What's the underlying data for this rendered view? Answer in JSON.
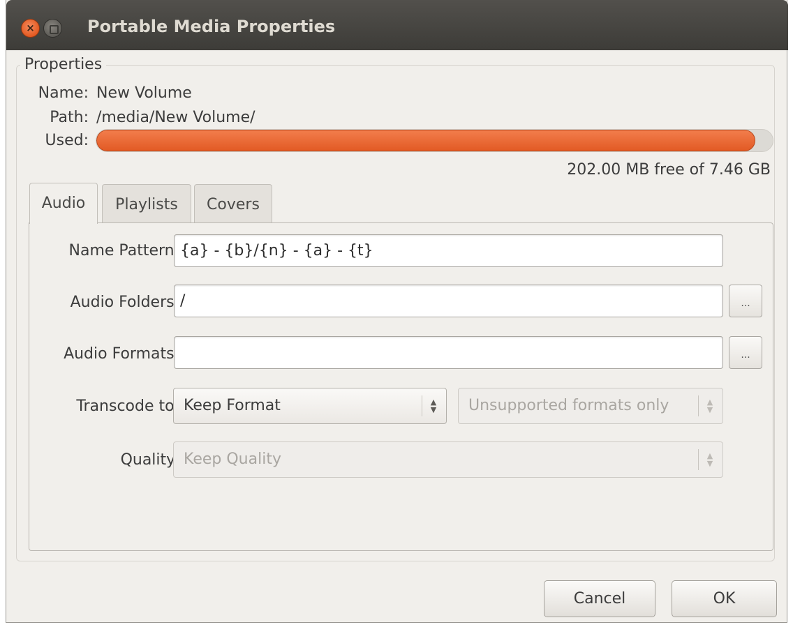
{
  "window": {
    "title": "Portable Media Properties",
    "close_glyph": "×"
  },
  "properties": {
    "group_title": "Properties",
    "name_label": "Name:",
    "name_value": "New Volume",
    "path_label": "Path:",
    "path_value": "/media/New Volume/",
    "used_label": "Used:",
    "used_fraction": 0.974,
    "free_text": "202.00 MB free of 7.46 GB"
  },
  "tabs": [
    {
      "label": "Audio",
      "active": true
    },
    {
      "label": "Playlists",
      "active": false
    },
    {
      "label": "Covers",
      "active": false
    }
  ],
  "audio": {
    "name_pattern_label": "Name Pattern:",
    "name_pattern_value": "{a} - {b}/{n} - {a} - {t}",
    "audio_folders_label": "Audio Folders:",
    "audio_folders_value": "/",
    "audio_folders_button": "...",
    "audio_formats_label": "Audio Formats:",
    "audio_formats_value": "",
    "audio_formats_button": "...",
    "transcode_label": "Transcode to:",
    "transcode_value": "Keep Format",
    "transcode_condition_value": "Unsupported formats only",
    "quality_label": "Quality:",
    "quality_value": "Keep Quality",
    "spinner_up": "▲",
    "spinner_down": "▼"
  },
  "buttons": {
    "cancel": "Cancel",
    "ok": "OK"
  },
  "colors": {
    "accent_orange": "#e8622b",
    "titlebar": "#3d3c38",
    "window_bg": "#f1efeb"
  }
}
